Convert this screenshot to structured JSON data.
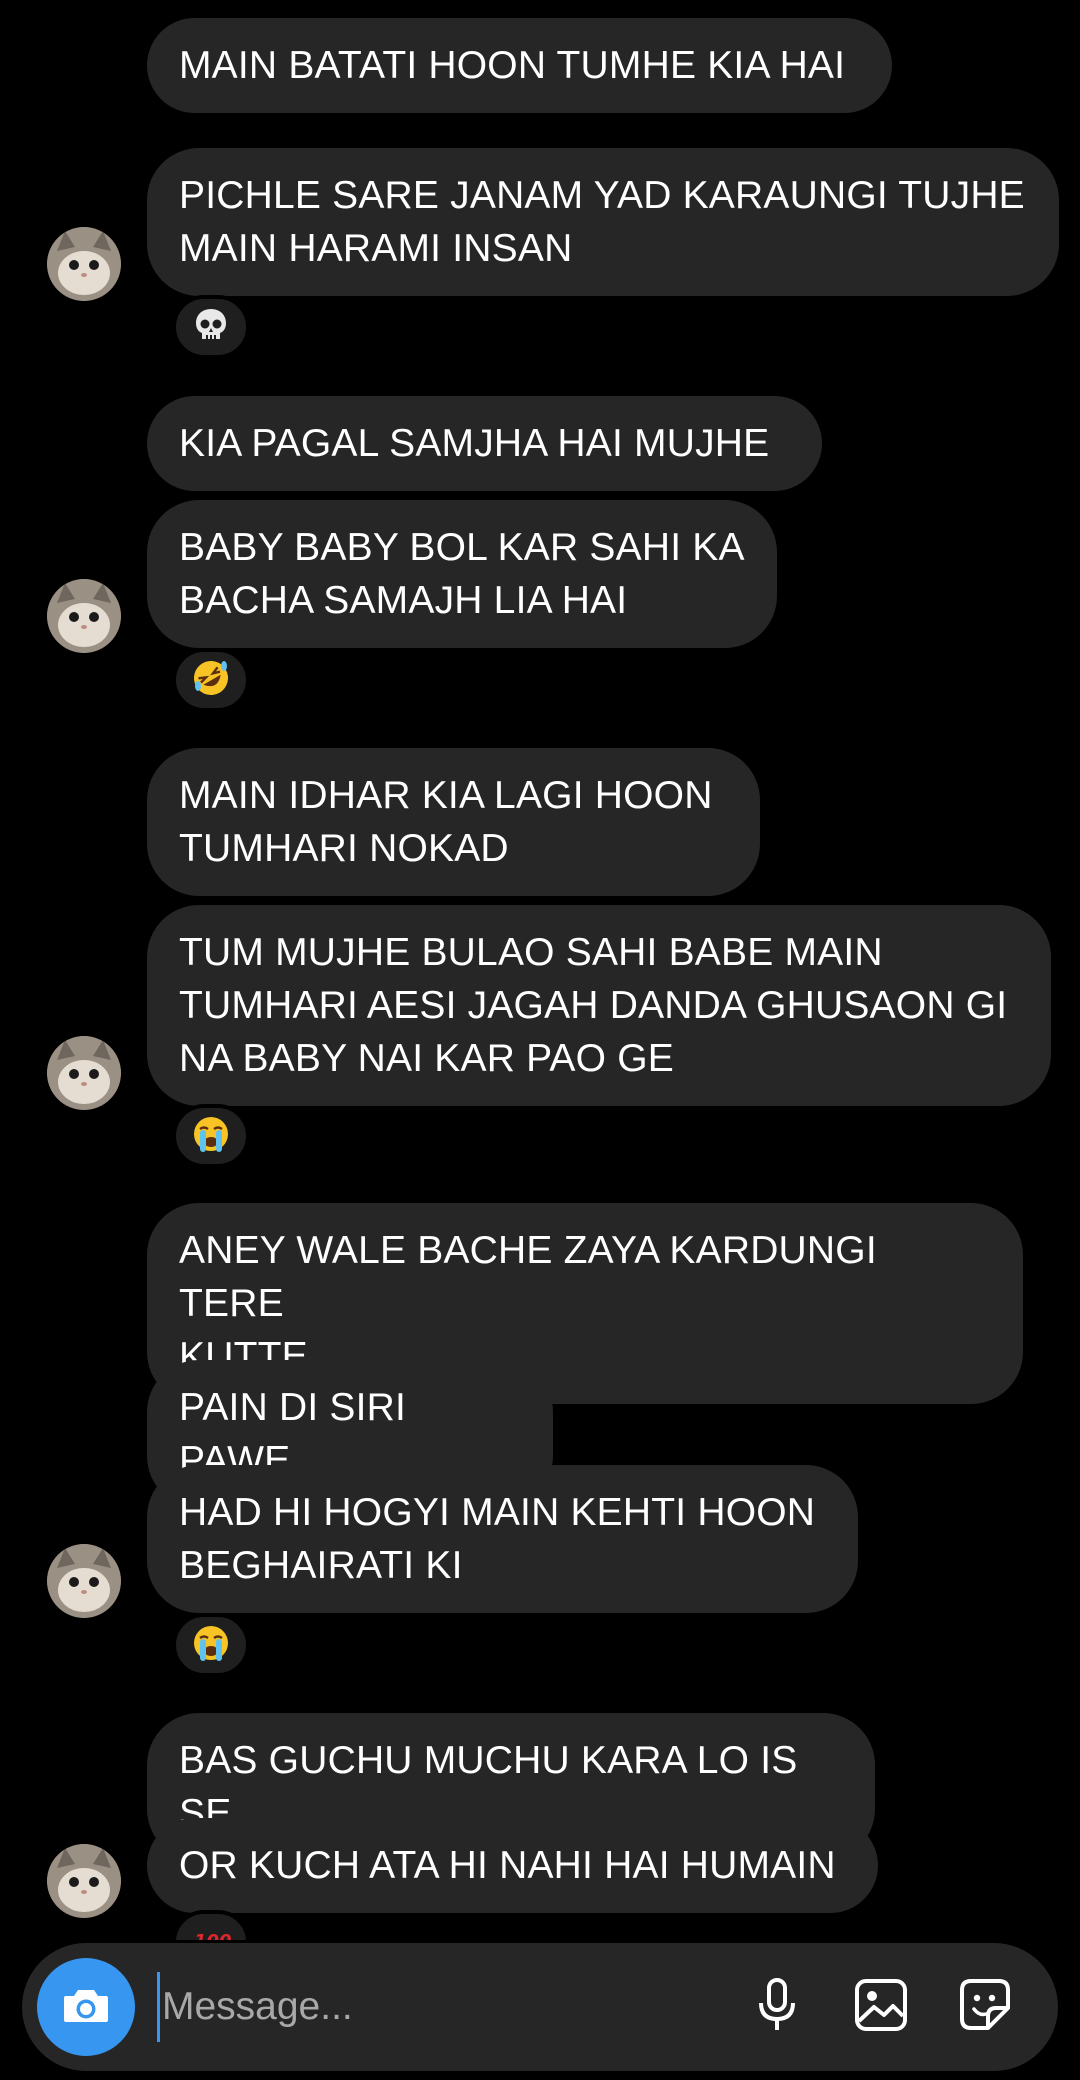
{
  "messages": [
    {
      "text": "MAIN BATATI HOON TUMHE KIA HAI"
    },
    {
      "text": "PICHLE SARE JANAM YAD KARAUNGI TUJHE\nMAIN HARAMI INSAN",
      "reaction": "skull"
    },
    {
      "text": "KIA PAGAL SAMJHA HAI MUJHE"
    },
    {
      "text": "BABY BABY BOL KAR SAHI KA\nBACHA SAMAJH LIA HAI",
      "reaction": "rolling-on-floor-laughing"
    },
    {
      "text": "MAIN IDHAR KIA LAGI HOON\nTUMHARI NOKAD"
    },
    {
      "text": "TUM MUJHE BULAO SAHI BABE MAIN\nTUMHARI AESI JAGAH DANDA GHUSAON GI\nNA BABY NAI KAR PAO GE",
      "reaction": "loudly-crying"
    },
    {
      "text": "ANEY WALE BACHE ZAYA KARDUNGI TERE\nKUTTE"
    },
    {
      "text": "PAIN DI SIRI PAWE"
    },
    {
      "text": "HAD HI HOGYI MAIN KEHTI HOON\nBEGHAIRATI KI",
      "reaction": "loudly-crying"
    },
    {
      "text": "BAS GUCHU MUCHU KARA LO IS SE"
    },
    {
      "text": "OR KUCH ATA HI NAHI HAI HUMAIN",
      "reaction": "hundred-points"
    }
  ],
  "composer": {
    "placeholder": "Message...",
    "icons": [
      "camera-icon",
      "microphone-icon",
      "gallery-icon",
      "sticker-icon"
    ]
  },
  "colors": {
    "background": "#000000",
    "bubble": "#262626",
    "accent": "#3797f0"
  }
}
